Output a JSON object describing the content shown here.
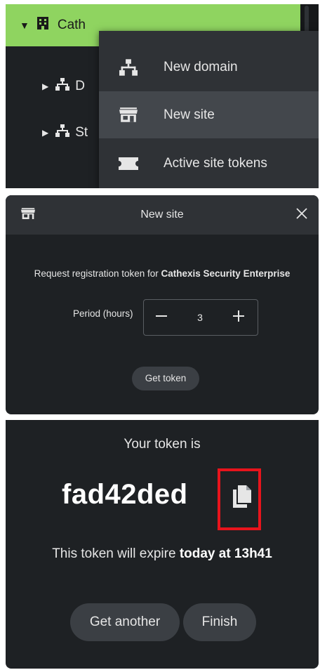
{
  "tree": {
    "selected_label": "Cath",
    "rows": [
      {
        "label": "D",
        "icon": "network-icon"
      },
      {
        "label": "St",
        "icon": "network-icon"
      }
    ],
    "accent": "#8fd460"
  },
  "context_menu": {
    "items": [
      {
        "label": "New domain",
        "icon": "network-icon"
      },
      {
        "label": "New site",
        "icon": "storefront-icon",
        "highlighted": true
      },
      {
        "label": "Active site tokens",
        "icon": "ticket-icon"
      }
    ]
  },
  "dialog": {
    "title": "New site",
    "request_prefix": "Request registration token for ",
    "request_target": "Cathexis Security Enterprise",
    "period_label": "Period (hours)",
    "period_value": "3",
    "get_token_label": "Get token"
  },
  "result": {
    "heading": "Your token is",
    "token": "fad42ded",
    "expire_prefix": "This token will expire ",
    "expire_time": "today at 13h41",
    "get_another_label": "Get another",
    "finish_label": "Finish",
    "highlight_color": "#e8141c"
  }
}
